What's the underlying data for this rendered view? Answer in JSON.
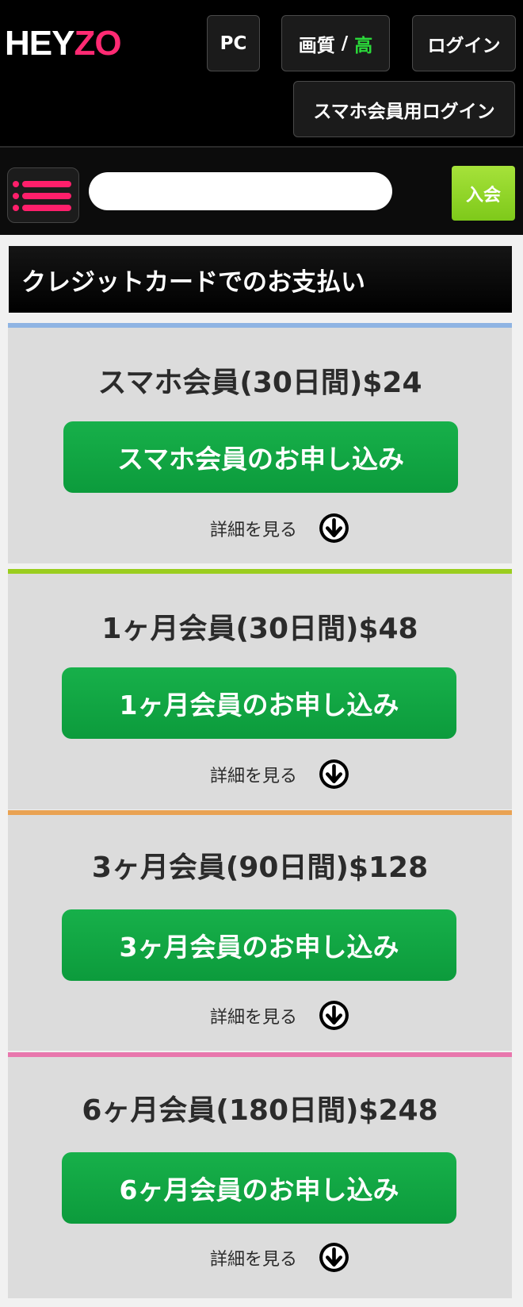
{
  "header": {
    "logo_part1": "HEY",
    "logo_part2": "ZO",
    "pc_label": "PC",
    "quality_label": "画質",
    "quality_sep": "/",
    "quality_value": "高",
    "login_label": "ログイン",
    "smartphone_login_label": "スマホ会員用ログイン"
  },
  "search": {
    "placeholder": "",
    "value": "",
    "join_label": "入会"
  },
  "section": {
    "title": "クレジットカードでのお支払い"
  },
  "plans": [
    {
      "title": "スマホ会員(30日間)$24",
      "button": "スマホ会員のお申し込み",
      "details": "詳細を見る",
      "accent": "#8fb4e3"
    },
    {
      "title": "1ヶ月会員(30日間)$48",
      "button": "1ヶ月会員のお申し込み",
      "details": "詳細を見る",
      "accent": "#9acd1e"
    },
    {
      "title": "3ヶ月会員(90日間)$128",
      "button": "3ヶ月会員のお申し込み",
      "details": "詳細を見る",
      "accent": "#e9a253"
    },
    {
      "title": "6ヶ月会員(180日間)$248",
      "button": "6ヶ月会員のお申し込み",
      "details": "詳細を見る",
      "accent": "#e877ad"
    }
  ],
  "colors": {
    "logo_pink": "#ff2a73",
    "quality_green": "#2bd93a",
    "apply_green": "#12a845",
    "join_green": "#8fd62a",
    "menu_pink": "#ff1f6b"
  },
  "icons": {
    "menu": "hamburger-menu-icon",
    "details": "arrow-down-circle-icon"
  }
}
